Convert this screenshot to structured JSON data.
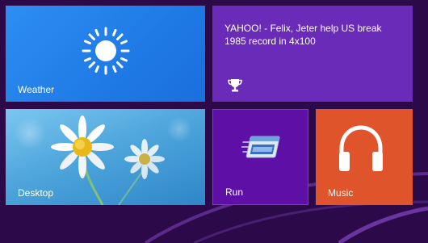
{
  "tiles": {
    "weather": {
      "label": "Weather",
      "icon": "sun-icon",
      "color": "#2284ea"
    },
    "news": {
      "headline": "YAHOO! - Felix, Jeter help US break 1985 record in 4x100",
      "icon": "trophy-icon",
      "color": "#6a2bb8"
    },
    "desktop": {
      "label": "Desktop",
      "color": "#4ea6dc"
    },
    "run": {
      "label": "Run",
      "icon": "run-window-icon",
      "color": "#5d0fa6"
    },
    "music": {
      "label": "Music",
      "icon": "headphones-icon",
      "color": "#e0542b"
    }
  },
  "background": {
    "color": "#2c0a4a"
  }
}
